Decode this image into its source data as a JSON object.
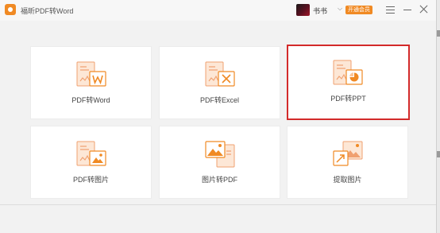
{
  "window": {
    "title": "福昕PDF转Word"
  },
  "user": {
    "name": "书书",
    "badge": "开通会员"
  },
  "cards": [
    {
      "id": "pdf-to-word",
      "label": "PDF转Word",
      "icon": "word-doc-icon",
      "selected": false
    },
    {
      "id": "pdf-to-excel",
      "label": "PDF转Excel",
      "icon": "excel-doc-icon",
      "selected": false
    },
    {
      "id": "pdf-to-ppt",
      "label": "PDF转PPT",
      "icon": "ppt-doc-icon",
      "selected": true
    },
    {
      "id": "pdf-to-image",
      "label": "PDF转图片",
      "icon": "pdf-image-icon",
      "selected": false
    },
    {
      "id": "image-to-pdf",
      "label": "图片转PDF",
      "icon": "image-pdf-icon",
      "selected": false
    },
    {
      "id": "extract-image",
      "label": "提取图片",
      "icon": "extract-image-icon",
      "selected": false
    }
  ],
  "colors": {
    "accent": "#f08a24",
    "icon_fill": "#fde7d6",
    "selection": "#d32a2a"
  }
}
